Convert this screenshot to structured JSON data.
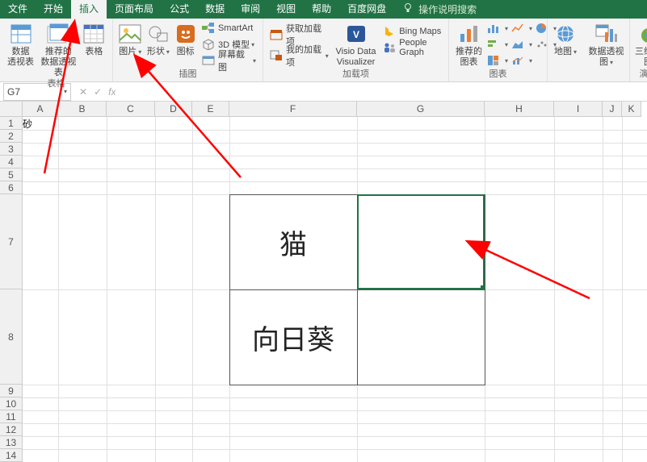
{
  "tabs": {
    "file": "文件",
    "home": "开始",
    "insert": "插入",
    "page_layout": "页面布局",
    "formulas": "公式",
    "data": "数据",
    "review": "审阅",
    "view": "视图",
    "help": "帮助",
    "baidu": "百度网盘",
    "tell_me": "操作说明搜索"
  },
  "ribbon": {
    "tables": {
      "pivot": "数据\n透视表",
      "rec_pivot": "推荐的\n数据透视表",
      "table": "表格",
      "group": "表格"
    },
    "illus": {
      "pictures": "图片",
      "shapes": "形状",
      "icons": "图标",
      "smartart": "SmartArt",
      "model3d": "3D 模型",
      "screenshot": "屏幕截图",
      "group": "插图"
    },
    "addins": {
      "get": "获取加载项",
      "my": "我的加载项",
      "visio": "Visio Data\nVisualizer",
      "bing": "Bing Maps",
      "people": "People Graph",
      "group": "加载项"
    },
    "charts": {
      "recommended": "推荐的\n图表",
      "maps": "地图",
      "pivot_chart": "数据透视图",
      "group": "图表"
    },
    "tours": {
      "map3d": "三维地\n图",
      "group": "演示"
    }
  },
  "formula_bar": {
    "name_box": "G7",
    "fx": "fx"
  },
  "columns": [
    "A",
    "B",
    "C",
    "D",
    "E",
    "F",
    "G",
    "H",
    "I",
    "J",
    "K"
  ],
  "rows": [
    "1",
    "2",
    "3",
    "4",
    "5",
    "6",
    "7",
    "8",
    "9",
    "10",
    "11",
    "12",
    "13",
    "14"
  ],
  "cells": {
    "F7": "猫",
    "F8": "向日葵"
  },
  "selected_cell": "G7"
}
